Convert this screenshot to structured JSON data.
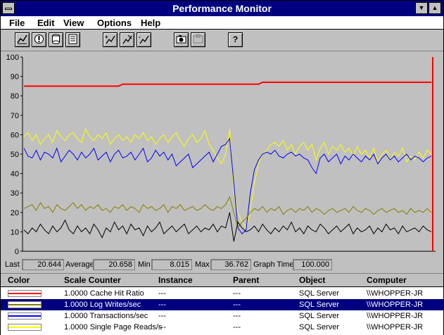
{
  "window": {
    "title": "Performance Monitor"
  },
  "menu": [
    "File",
    "Edit",
    "View",
    "Options",
    "Help"
  ],
  "toolbar": {
    "buttons": [
      "chart-view-icon",
      "alert-view-icon",
      "log-view-icon",
      "report-view-icon",
      "add-counter-icon",
      "edit-counter-icon",
      "delete-counter-icon",
      "update-now-icon",
      "bookmark-icon",
      "options-icon"
    ],
    "help_label": "?"
  },
  "stats": {
    "last_label": "Last",
    "last": "20.644",
    "avg_label": "Average",
    "avg": "20.658",
    "min_label": "Min",
    "min": "8.015",
    "max_label": "Max",
    "max": "36.762",
    "graph_time_label": "Graph Time",
    "graph_time": "100.000"
  },
  "legend_headers": {
    "color": "Color",
    "scale_counter": "Scale Counter",
    "instance": "Instance",
    "parent": "Parent",
    "object": "Object",
    "computer": "Computer"
  },
  "legend_rows": [
    {
      "color": "#ff0000",
      "scale": "1.0000",
      "counter": "Cache Hit Ratio",
      "instance": "---",
      "parent": "---",
      "object": "SQL Server",
      "computer": "\\\\WHOPPER-JR",
      "selected": false
    },
    {
      "color": "#808000",
      "scale": "1.0000",
      "counter": "Log Writes/sec",
      "instance": "---",
      "parent": "---",
      "object": "SQL Server",
      "computer": "\\\\WHOPPER-JR",
      "selected": true
    },
    {
      "color": "#0000ff",
      "scale": "1.0000",
      "counter": "Transactions/sec",
      "instance": "---",
      "parent": "---",
      "object": "SQL Server",
      "computer": "\\\\WHOPPER-JR",
      "selected": false
    },
    {
      "color": "#ffff00",
      "scale": "1.0000",
      "counter": "Single Page Reads/s",
      "instance": "---",
      "parent": "---",
      "object": "SQL Server",
      "computer": "\\\\WHOPPER-JR",
      "selected": false
    }
  ],
  "chart_data": {
    "type": "line",
    "ylim": [
      0,
      100
    ],
    "yticks": [
      "0",
      "10",
      "20",
      "30",
      "40",
      "50",
      "60",
      "70",
      "80",
      "90",
      "100"
    ],
    "grid": false,
    "series": [
      {
        "name": "Cache Hit Ratio",
        "color": "#ff0000",
        "values": [
          85,
          85,
          85,
          85,
          85,
          85,
          85,
          85,
          85,
          85,
          85,
          85,
          85,
          85,
          85,
          85,
          85,
          85,
          85,
          85,
          85,
          85,
          85,
          85,
          86,
          86,
          86,
          86,
          86,
          86,
          86,
          86,
          86,
          86,
          86,
          86,
          86,
          86,
          86,
          86,
          86,
          86,
          86,
          86,
          86,
          86,
          86,
          86,
          86,
          86,
          86,
          86,
          86,
          86,
          86,
          86,
          86,
          86,
          87,
          87,
          87,
          87,
          87,
          87,
          87,
          87,
          87,
          87,
          87,
          87,
          87,
          87,
          87,
          87,
          87,
          87,
          87,
          87,
          87,
          87,
          87,
          87,
          87,
          87,
          87,
          87,
          87,
          87,
          87,
          87,
          87,
          87,
          87,
          87,
          87,
          87,
          87,
          87,
          87,
          87
        ]
      },
      {
        "name": "Single Page Reads/s",
        "color": "#ffff00",
        "values": [
          59,
          61,
          57,
          60,
          55,
          58,
          60,
          56,
          62,
          59,
          57,
          60,
          61,
          58,
          56,
          63,
          59,
          57,
          60,
          58,
          61,
          55,
          58,
          60,
          57,
          59,
          56,
          60,
          58,
          61,
          57,
          59,
          55,
          58,
          60,
          56,
          59,
          61,
          57,
          54,
          58,
          60,
          56,
          58,
          62,
          55,
          52,
          48,
          45,
          50,
          63,
          30,
          20,
          15,
          12,
          20,
          35,
          45,
          50,
          52,
          55,
          56,
          54,
          57,
          52,
          55,
          50,
          54,
          56,
          52,
          55,
          47,
          53,
          56,
          50,
          54,
          52,
          55,
          51,
          53,
          49,
          54,
          50,
          52,
          48,
          53,
          46,
          50,
          52,
          47,
          51,
          49,
          53,
          46,
          49,
          47,
          51,
          48,
          52,
          50
        ]
      },
      {
        "name": "Transactions/sec",
        "color": "#0000ff",
        "values": [
          53,
          49,
          48,
          52,
          47,
          51,
          50,
          48,
          53,
          46,
          49,
          52,
          50,
          47,
          51,
          48,
          50,
          53,
          47,
          49,
          51,
          46,
          50,
          52,
          48,
          49,
          51,
          47,
          50,
          53,
          46,
          48,
          52,
          49,
          51,
          47,
          50,
          44,
          46,
          48,
          50,
          43,
          45,
          47,
          49,
          51,
          46,
          50,
          54,
          55,
          58,
          35,
          12,
          9,
          11,
          30,
          42,
          47,
          50,
          51,
          50,
          52,
          49,
          48,
          50,
          51,
          49,
          50,
          48,
          47,
          43,
          40,
          48,
          50,
          46,
          48,
          50,
          45,
          49,
          47,
          50,
          48,
          46,
          49,
          47,
          50,
          45,
          48,
          50,
          47,
          49,
          46,
          48,
          50,
          47,
          49,
          48,
          46,
          48,
          49
        ]
      },
      {
        "name": "Log Writes/sec",
        "color": "#808000",
        "values": [
          22,
          23,
          24,
          21,
          25,
          22,
          23,
          20,
          24,
          22,
          21,
          23,
          25,
          22,
          24,
          21,
          23,
          22,
          24,
          21,
          22,
          20,
          23,
          22,
          24,
          21,
          23,
          22,
          20,
          24,
          22,
          23,
          21,
          22,
          24,
          20,
          23,
          22,
          24,
          21,
          22,
          23,
          21,
          22,
          24,
          22,
          21,
          23,
          22,
          24,
          28,
          20,
          12,
          15,
          17,
          20,
          22,
          21,
          23,
          20,
          22,
          21,
          23,
          19,
          21,
          22,
          20,
          22,
          21,
          23,
          20,
          22,
          21,
          19,
          21,
          22,
          20,
          21,
          22,
          20,
          23,
          21,
          20,
          22,
          21,
          19,
          21,
          22,
          20,
          21,
          22,
          20,
          21,
          19,
          22,
          20,
          21,
          20,
          22,
          20
        ]
      },
      {
        "name": "Cache Hit Ratio (black)",
        "color": "#000000",
        "values": [
          11,
          9,
          12,
          10,
          14,
          11,
          9,
          13,
          10,
          12,
          16,
          11,
          9,
          13,
          10,
          12,
          9,
          14,
          11,
          7,
          12,
          10,
          15,
          11,
          13,
          9,
          14,
          11,
          12,
          8,
          13,
          10,
          12,
          15,
          9,
          11,
          13,
          10,
          12,
          14,
          9,
          11,
          13,
          10,
          12,
          11,
          14,
          10,
          13,
          12,
          20,
          5,
          15,
          12,
          10,
          11,
          13,
          10,
          14,
          11,
          9,
          12,
          10,
          13,
          11,
          15,
          10,
          12,
          9,
          13,
          11,
          10,
          14,
          12,
          9,
          11,
          13,
          10,
          12,
          14,
          9,
          12,
          10,
          11,
          13,
          9,
          12,
          10,
          14,
          11,
          12,
          9,
          13,
          10,
          11,
          12,
          10,
          13,
          11,
          10
        ]
      }
    ]
  }
}
